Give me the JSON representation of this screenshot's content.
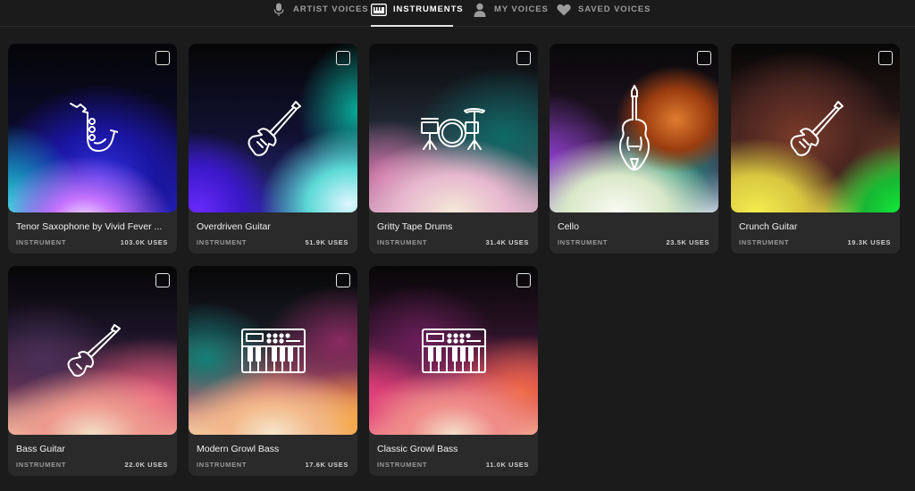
{
  "tabs": [
    {
      "label": "ARTIST VOICES",
      "icon": "microphone-icon",
      "active": false
    },
    {
      "label": "INSTRUMENTS",
      "icon": "piano-icon",
      "active": true
    },
    {
      "label": "MY VOICES",
      "icon": "person-icon",
      "active": false
    },
    {
      "label": "SAVED VOICES",
      "icon": "heart-icon",
      "active": false
    }
  ],
  "cards": [
    {
      "name": "Tenor Saxophone by Vivid Fever ...",
      "type": "INSTRUMENT",
      "uses": "103.0K USES",
      "icon": "saxophone-icon"
    },
    {
      "name": "Overdriven Guitar",
      "type": "INSTRUMENT",
      "uses": "51.9K USES",
      "icon": "electric-guitar-icon"
    },
    {
      "name": "Gritty Tape Drums",
      "type": "INSTRUMENT",
      "uses": "31.4K USES",
      "icon": "drum-kit-icon"
    },
    {
      "name": "Cello",
      "type": "INSTRUMENT",
      "uses": "23.5K USES",
      "icon": "cello-icon"
    },
    {
      "name": "Crunch Guitar",
      "type": "INSTRUMENT",
      "uses": "19.3K USES",
      "icon": "electric-guitar-icon"
    },
    {
      "name": "Bass Guitar",
      "type": "INSTRUMENT",
      "uses": "22.0K USES",
      "icon": "bass-guitar-icon"
    },
    {
      "name": "Modern Growl Bass",
      "type": "INSTRUMENT",
      "uses": "17.6K USES",
      "icon": "synthesizer-icon"
    },
    {
      "name": "Classic Growl Bass",
      "type": "INSTRUMENT",
      "uses": "11.0K USES",
      "icon": "synthesizer-icon"
    }
  ]
}
